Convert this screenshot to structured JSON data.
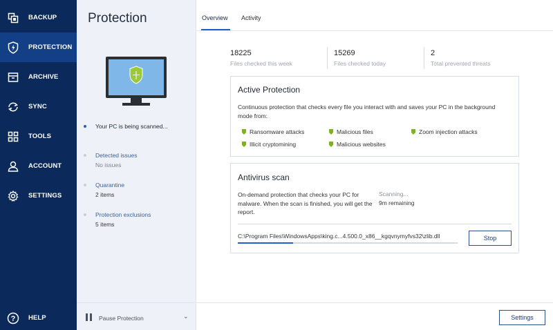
{
  "nav": {
    "items": [
      {
        "label": "BACKUP",
        "icon": "backup-icon"
      },
      {
        "label": "PROTECTION",
        "icon": "shield-icon"
      },
      {
        "label": "ARCHIVE",
        "icon": "archive-icon"
      },
      {
        "label": "SYNC",
        "icon": "sync-icon"
      },
      {
        "label": "TOOLS",
        "icon": "tools-icon"
      },
      {
        "label": "ACCOUNT",
        "icon": "account-icon"
      },
      {
        "label": "SETTINGS",
        "icon": "gear-icon"
      }
    ],
    "help": {
      "label": "HELP",
      "icon": "help-icon"
    },
    "active": "PROTECTION"
  },
  "panel": {
    "title": "Protection",
    "status": "Your PC is being scanned...",
    "sections": [
      {
        "title": "Detected issues",
        "value": "No issues"
      },
      {
        "title": "Quarantine",
        "value": "2 items"
      },
      {
        "title": "Protection exclusions",
        "value": "5 items"
      }
    ],
    "pause_label": "Pause Protection"
  },
  "tabs": [
    {
      "label": "Overview",
      "active": true
    },
    {
      "label": "Activity",
      "active": false
    }
  ],
  "stats": [
    {
      "value": "18225",
      "label": "Files checked this week"
    },
    {
      "value": "15269",
      "label": "Files checked today"
    },
    {
      "value": "2",
      "label": "Total prevented threats"
    }
  ],
  "active_protection": {
    "title": "Active Protection",
    "description": "Continuous protection that checks every file you interact with and saves your PC in the background mode from:",
    "features": [
      "Ransomware attacks",
      "Malicious files",
      "Zoom injection attacks",
      "Illicit cryptomining",
      "Malicious websites"
    ]
  },
  "antivirus": {
    "title": "Antivirus scan",
    "description": "On-demand protection that checks your PC for malware. When the scan is finished, you will get the report.",
    "status": "Scanning...",
    "remaining": "9m remaining",
    "current_file": "C:\\Program Files\\WindowsApps\\king.c...4.500.0_x86__kgqvnymyfvs32\\zlib.dll",
    "progress": 0.25,
    "stop_label": "Stop"
  },
  "footer": {
    "settings_label": "Settings"
  },
  "colors": {
    "nav_bg": "#0b2a5b",
    "nav_active": "#123f86",
    "accent": "#1f5fcc",
    "feature_green": "#7cb518"
  }
}
